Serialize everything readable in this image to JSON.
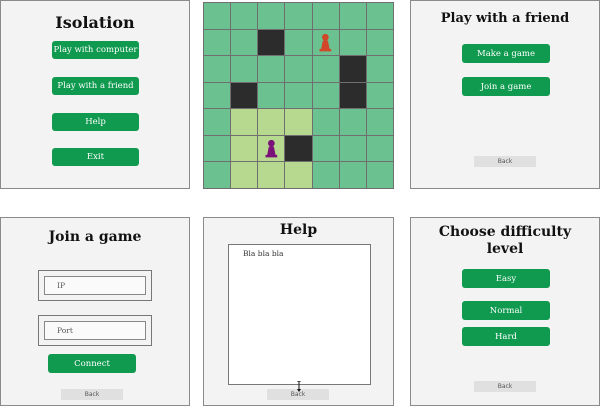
{
  "menu": {
    "title": "Isolation",
    "buttons": [
      "Play with computer",
      "Play with a friend",
      "Help",
      "Exit"
    ]
  },
  "board": {
    "size": 7,
    "blocked": [
      [
        1,
        2
      ],
      [
        2,
        5
      ],
      [
        3,
        1
      ],
      [
        3,
        5
      ],
      [
        5,
        3
      ]
    ],
    "highlighted": [
      [
        4,
        1
      ],
      [
        4,
        2
      ],
      [
        4,
        3
      ],
      [
        5,
        1
      ],
      [
        5,
        2
      ],
      [
        6,
        1
      ],
      [
        6,
        2
      ],
      [
        6,
        3
      ]
    ],
    "players": [
      {
        "name": "pawn-red-icon",
        "color": "#d0472a",
        "row": 1,
        "col": 4
      },
      {
        "name": "pawn-purple-icon",
        "color": "#7a127a",
        "row": 5,
        "col": 2
      }
    ]
  },
  "friend": {
    "title": "Play with a friend",
    "make_label": "Make a game",
    "join_label": "Join a game",
    "back_label": "Back"
  },
  "join": {
    "title": "Join a game",
    "ip_placeholder": "IP",
    "port_placeholder": "Port",
    "connect_label": "Connect",
    "back_label": "Back"
  },
  "help": {
    "title": "Help",
    "text": "Bla bla bla",
    "back_label": "Back"
  },
  "difficulty": {
    "title": "Choose difficulty level",
    "options": [
      "Easy",
      "Normal",
      "Hard"
    ],
    "back_label": "Back"
  }
}
